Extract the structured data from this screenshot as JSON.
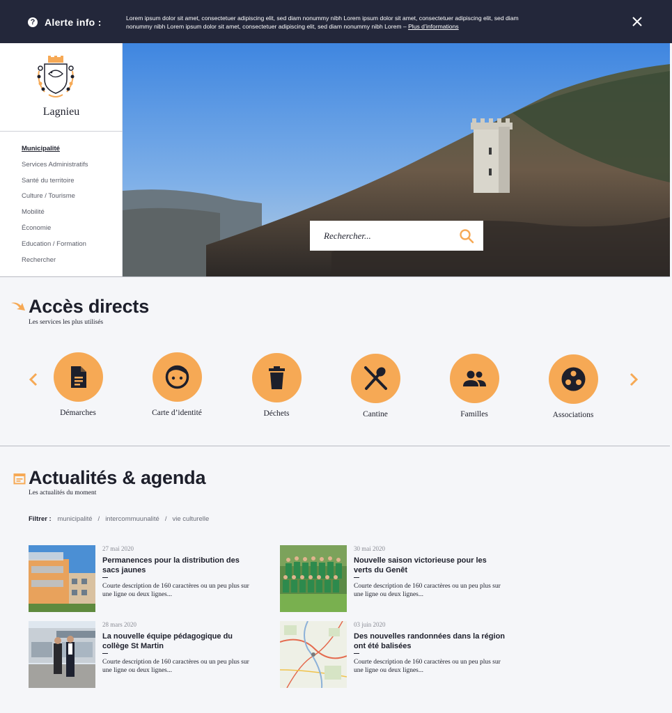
{
  "alert": {
    "title": "Alerte info :",
    "message": "Lorem ipsum dolor sit amet, consectetuer adipiscing elit, sed diam nonummy nibh Lorem ipsum dolor sit amet, consectetuer adipiscing elit, sed diam nonummy nibh Lorem ipsum dolor sit amet, consectetuer adipiscing elit, sed diam nonummy nibh Lorem –",
    "link": "Plus d’informations",
    "icon": "question-circle-icon",
    "close_icon": "close-icon"
  },
  "site": {
    "name": "Lagnieu"
  },
  "nav": [
    "Municipalité",
    "Services Administratifs",
    "Santé du territoire",
    "Culture / Tourisme",
    "Mobilité",
    "Économie",
    "Education / Formation",
    "Rechercher"
  ],
  "search": {
    "placeholder": "Rechercher..."
  },
  "quick_access": {
    "title": "Accès directs",
    "subtitle": "Les services les plus utilisés",
    "items": [
      {
        "label": "Démarches",
        "icon": "document-icon"
      },
      {
        "label": "Carte d’identité",
        "icon": "face-icon"
      },
      {
        "label": "Déchets",
        "icon": "trash-icon"
      },
      {
        "label": "Cantine",
        "icon": "utensils-icon"
      },
      {
        "label": "Familles",
        "icon": "people-icon"
      },
      {
        "label": "Associations",
        "icon": "group-circle-icon"
      }
    ]
  },
  "news": {
    "title": "Actualités & agenda",
    "subtitle": "Les actualités du moment",
    "filter_label": "Filtrer :",
    "filters": [
      "municipalité",
      "intercommuunalité",
      "vie culturelle"
    ],
    "articles": [
      {
        "date": "27 mai 2020",
        "title": "Permanences pour la distribution des sacs jaunes",
        "desc": "Courte description de 160 caractères ou un peu plus sur une ligne ou deux lignes..."
      },
      {
        "date": "30 mai 2020",
        "title": "Nouvelle saison victorieuse pour les verts du Genêt",
        "desc": "Courte description de 160 caractères ou un peu plus sur une ligne ou deux lignes..."
      },
      {
        "date": "28 mars 2020",
        "title": "La nouvelle équipe pédagogique du collège St Martin",
        "desc": "Courte description de 160 caractères ou un peu plus sur une ligne ou deux lignes..."
      },
      {
        "date": "03 juin 2020",
        "title": "Des nouvelles randonnées dans la région ont été balisées",
        "desc": "Courte description de 160 caractères ou un peu plus sur une ligne ou deux lignes..."
      }
    ]
  },
  "colors": {
    "accent": "#f6a955",
    "dark": "#23273a",
    "text": "#1d1f2b"
  }
}
